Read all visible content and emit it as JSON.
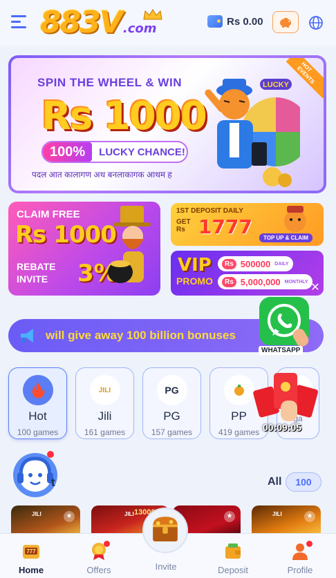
{
  "header": {
    "logo_main": "883V",
    "logo_sub": ".com",
    "balance": "Rs 0.00"
  },
  "banner": {
    "title": "SPIN THE WHEEL & WIN",
    "amount": "Rs 1000",
    "pill_percent": "100%",
    "pill_text": "LUCKY CHANCE!",
    "strip_text": "पदल आत कालागण अथ बनलाकागक आथम ह",
    "hot_tag": "HOT EVENTS",
    "wheel_label": "LUCKY"
  },
  "promo_left": {
    "line1": "CLAIM FREE",
    "line2": "Rs 1000",
    "line3a": "REBATE",
    "line3b": "INVITE",
    "line4": "3%"
  },
  "promo_right_top": {
    "line1": "1ST DEPOSIT DAILY",
    "line2a": "GET",
    "line2b": "Rs",
    "amount": "1777",
    "button": "TOP UP & CLAIM"
  },
  "promo_right_bottom": {
    "vip": "VIP",
    "promo": "PROMO",
    "row1_amount": "500000",
    "row1_label": "DAILY",
    "row2_amount": "5,000,000",
    "row2_label": "MONTHLY",
    "rs": "Rs"
  },
  "marquee": {
    "text": "will give away 100 billion bonuses"
  },
  "whatsapp_label": "WHATSAPP",
  "categories": [
    {
      "name": "Hot",
      "count": "100 games"
    },
    {
      "name": "Jili",
      "count": "161 games"
    },
    {
      "name": "PG",
      "count": "157 games"
    },
    {
      "name": "PP",
      "count": "419 games"
    },
    {
      "name": "",
      "count": "ga"
    }
  ],
  "category_icons": {
    "jili": "JILI",
    "pg": "PG"
  },
  "timer": "00:09:05",
  "section": {
    "title_partial": "t",
    "all_label": "All",
    "all_count": "100"
  },
  "games": [
    {
      "tag": "JILI"
    },
    {
      "tag": "JILI",
      "extra": "13000"
    },
    {
      "tag": ""
    },
    {
      "tag": "JILI"
    }
  ],
  "bottom_nav": [
    {
      "label": "Home"
    },
    {
      "label": "Offers"
    },
    {
      "label": "Invite"
    },
    {
      "label": "Deposit"
    },
    {
      "label": "Profile"
    }
  ],
  "colors": {
    "accent": "#4a6cf7",
    "marquee_text": "#ffd93a",
    "badge_red": "#ff2d3a"
  }
}
